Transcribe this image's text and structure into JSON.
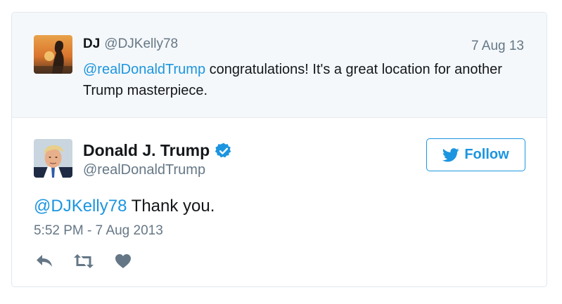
{
  "reply": {
    "avatar_icon": "sunset-silhouette-avatar",
    "name": "DJ",
    "handle": "@DJKelly78",
    "date": "7 Aug 13",
    "mention": "@realDonaldTrump",
    "text": " congratulations! It's a great location for another Trump masterpiece."
  },
  "tweet": {
    "avatar_icon": "portrait-avatar",
    "name": "Donald J. Trump",
    "verified_icon": "verified-badge-icon",
    "handle": "@realDonaldTrump",
    "follow_label": "Follow",
    "mention": "@DJKelly78",
    "text": " Thank you.",
    "timestamp": "5:52 PM - 7 Aug 2013"
  },
  "actions": {
    "reply_icon": "reply-icon",
    "retweet_icon": "retweet-icon",
    "like_icon": "heart-icon"
  },
  "colors": {
    "accent": "#1b95e0",
    "muted": "#657786",
    "text": "#14171a",
    "reply_bg": "#f5f8fa",
    "border": "#e1e8ed"
  }
}
